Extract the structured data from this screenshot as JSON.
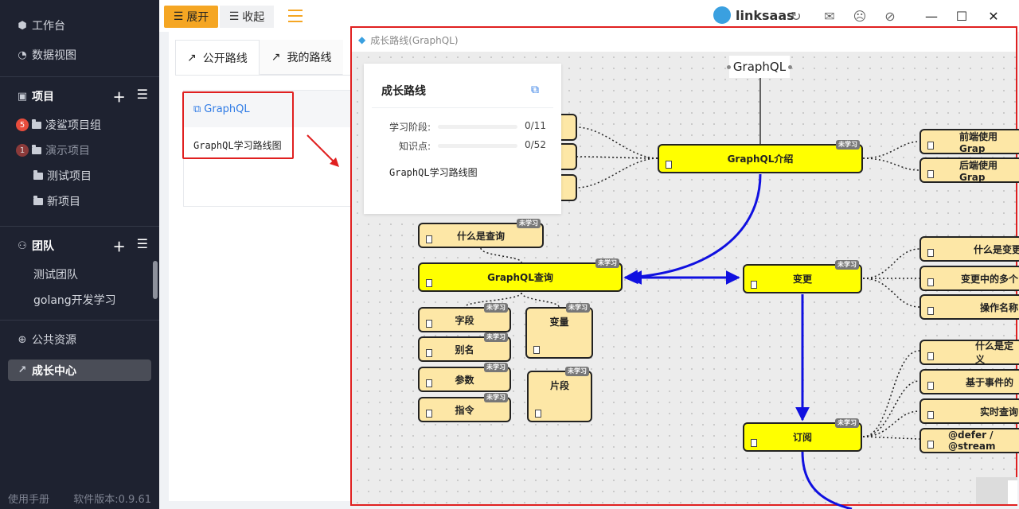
{
  "sidebar": {
    "workbench": "工作台",
    "data_view": "数据视图",
    "projects_header": "项目",
    "projects": [
      {
        "label": "凌鲨项目组",
        "badge": "5"
      },
      {
        "label": "演示项目",
        "badge": "1"
      },
      {
        "label": "测试项目"
      },
      {
        "label": "新项目"
      }
    ],
    "teams_header": "团队",
    "teams": [
      "测试团队",
      "golang开发学习"
    ],
    "public_resources": "公共资源",
    "growth_center": "成长中心",
    "manual": "使用手册",
    "version": "软件版本:0.9.61"
  },
  "topbar": {
    "expand": "展开",
    "collapse": "收起",
    "brand": "linksaas"
  },
  "tabs": {
    "public": "公开路线",
    "mine": "我的路线"
  },
  "route_card": {
    "title": "GraphQL",
    "desc": "GraphQL学习路线图"
  },
  "graph_window": {
    "title": "成长路线(GraphQL)",
    "root": "GraphQL",
    "tag": "未学习",
    "nodes": {
      "intro": "GraphQL介绍",
      "query": "GraphQL查询",
      "what_query": "什么是查询",
      "field": "字段",
      "alias": "别名",
      "args": "参数",
      "directive": "指令",
      "variable": "变量",
      "fragment": "片段",
      "mutation": "变更",
      "what_mutation": "什么是变更",
      "multi_mutation": "变更中的多个",
      "op_name": "操作名称",
      "subscription": "订阅",
      "what_def": "什么是定义",
      "event_based": "基于事件的",
      "realtime": "实时查询",
      "defer_stream": "@defer / @stream",
      "frontend": "前端使用Grap",
      "backend": "后端使用Grap"
    }
  },
  "info_panel": {
    "title": "成长路线",
    "stage_label": "学习阶段:",
    "stage_value": "0/11",
    "stage_progress": 0,
    "knowledge_label": "知识点:",
    "knowledge_value": "0/52",
    "knowledge_progress": 0,
    "desc": "GraphQL学习路线图"
  },
  "colors": {
    "accent": "#f5a623",
    "highlight": "#e02020",
    "link": "#2f7be5",
    "node_main": "#ffff00",
    "node_sub": "#fde7a6",
    "edge_main": "#1010e0"
  }
}
